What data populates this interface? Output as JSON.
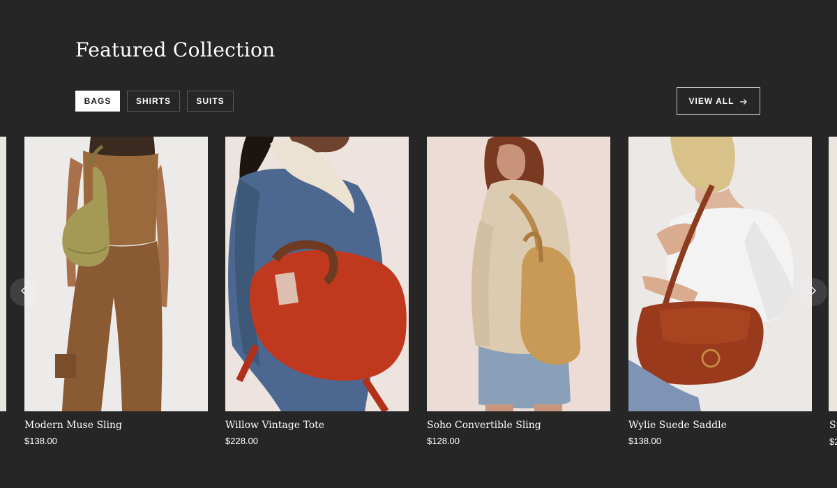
{
  "section": {
    "title": "Featured Collection"
  },
  "tabs": [
    {
      "label": "BAGS",
      "active": true
    },
    {
      "label": "SHIRTS",
      "active": false
    },
    {
      "label": "SUITS",
      "active": false
    }
  ],
  "view_all": {
    "label": "VIEW ALL",
    "icon": "arrow-right-icon"
  },
  "carousel": {
    "prev_icon": "chevron-left-icon",
    "next_icon": "chevron-right-icon"
  },
  "products": [
    {
      "name": "Modern Muse Sling",
      "price": "$138.00"
    },
    {
      "name": "Willow Vintage Tote",
      "price": "$228.00"
    },
    {
      "name": "Soho Convertible Sling",
      "price": "$128.00"
    },
    {
      "name": "Wylie Suede Saddle",
      "price": "$138.00"
    }
  ],
  "partial_next_product": {
    "name_fragment": "St",
    "price_fragment": "$2"
  },
  "colors": {
    "background": "#262626",
    "text": "#ffffff",
    "active_tab_bg": "#ffffff",
    "active_tab_text": "#1f1f1f"
  }
}
